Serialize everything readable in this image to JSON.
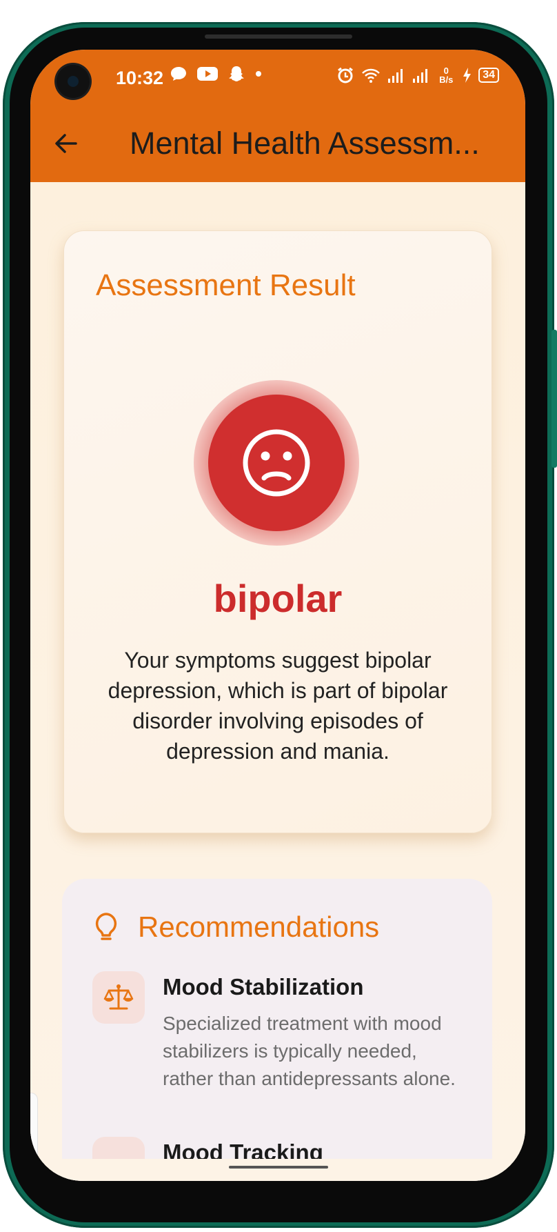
{
  "status_bar": {
    "time": "10:32",
    "left_icons": [
      "chat-bubble-icon",
      "youtube-icon",
      "snapchat-icon",
      "dot-icon"
    ],
    "right_icons": [
      "alarm-icon",
      "wifi-icon",
      "signal-icon",
      "signal-icon-2",
      "data-rate-icon",
      "charging-icon",
      "battery-icon"
    ],
    "data_rate": "0 B/s",
    "battery_level": "34"
  },
  "app_bar": {
    "title": "Mental Health Assessm..."
  },
  "result_card": {
    "heading": "Assessment Result",
    "icon": "sad-face-icon",
    "diagnosis": "bipolar",
    "description": "Your symptoms suggest bipolar depression, which is part of bipolar disorder involving episodes of depression and mania."
  },
  "recommendations": {
    "heading": "Recommendations",
    "icon": "lightbulb-icon",
    "items": [
      {
        "icon": "scale-icon",
        "title": "Mood Stabilization",
        "text": "Specialized treatment with mood stabilizers is typically needed, rather than antidepressants alone."
      },
      {
        "icon": "chart-icon",
        "title": "Mood Tracking",
        "text": ""
      }
    ]
  },
  "colors": {
    "accent": "#e26a10",
    "heading": "#e87512",
    "danger": "#d02f2f",
    "background": "#fdf0dd"
  }
}
